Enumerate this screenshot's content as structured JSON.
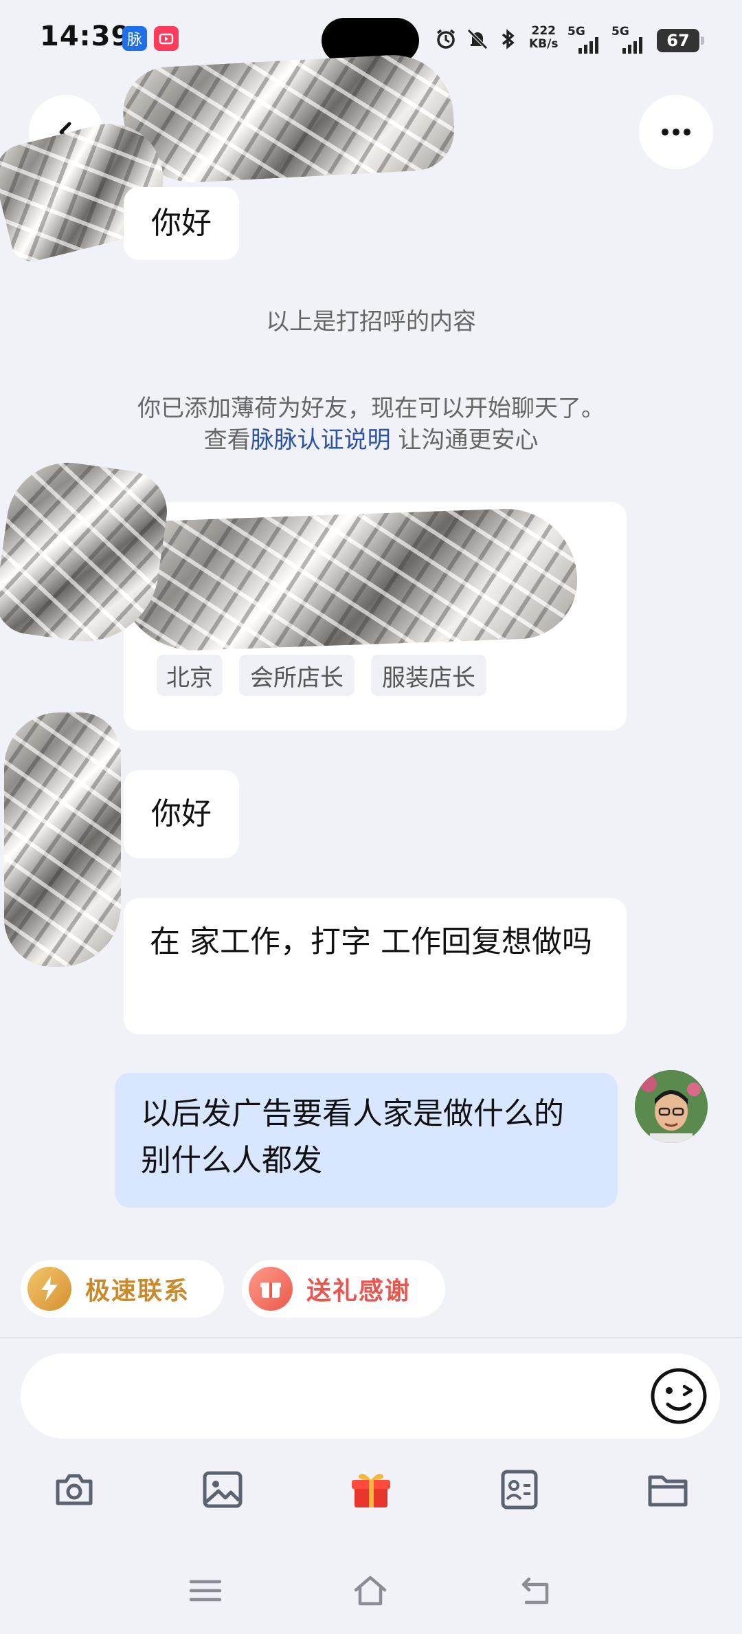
{
  "status_bar": {
    "time": "14:39",
    "app_badge_1": "脉",
    "net_speed_value": "222",
    "net_speed_unit": "KB/s",
    "signal_1": "5G",
    "signal_2": "5G",
    "battery": "67"
  },
  "header": {
    "back_icon": "chevron-left-icon",
    "more_icon": "more-dots-icon"
  },
  "messages": {
    "greeting_1": "你好",
    "greeting_hint": "以上是打招呼的内容",
    "friend_added": "你已添加薄荷为好友，现在可以开始聊天了。",
    "verify_prefix": "查看",
    "verify_link": "脉脉认证说明",
    "verify_suffix": " 让沟通更安心",
    "profile_tags": [
      "北京",
      "会所店长",
      "服装店长"
    ],
    "greeting_2": "你好",
    "offer_text": "在 家工作，打字 工作回复想做吗",
    "my_reply": "以后发广告要看人家是做什么的 别什么人都发"
  },
  "quick_actions": {
    "fast_contact": "极速联系",
    "gift_thanks": "送礼感谢"
  },
  "toolbar": {
    "items": [
      "camera-icon",
      "image-icon",
      "gift-icon",
      "contact-card-icon",
      "folder-icon"
    ]
  },
  "colors": {
    "link": "#2a52a8",
    "my_bubble": "#d9e6ff",
    "fast_contact": "#c98a2b",
    "gift_thanks": "#e8574f"
  }
}
